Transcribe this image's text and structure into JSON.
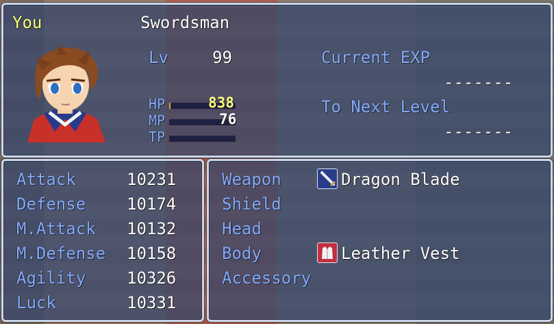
{
  "actor": {
    "name": "You",
    "class": "Swordsman",
    "level_label": "Lv",
    "level": "99",
    "hp_label": "HP",
    "hp": "838",
    "hp_fill_fraction": 0.02,
    "mp_label": "MP",
    "mp": "76",
    "mp_fill_fraction": 0,
    "tp_label": "TP",
    "tp_fill_fraction": 0
  },
  "exp": {
    "current_label": "Current EXP",
    "current_value": "-------",
    "next_label": "To Next Level",
    "next_value": "-------"
  },
  "params": [
    {
      "label": "Attack",
      "value": "10231"
    },
    {
      "label": "Defense",
      "value": "10174"
    },
    {
      "label": "M.Attack",
      "value": "10132"
    },
    {
      "label": "M.Defense",
      "value": "10158"
    },
    {
      "label": "Agility",
      "value": "10326"
    },
    {
      "label": "Luck",
      "value": "10331"
    }
  ],
  "equipment": [
    {
      "slot": "Weapon",
      "item": "Dragon Blade",
      "icon": "sword-icon"
    },
    {
      "slot": "Shield",
      "item": "",
      "icon": ""
    },
    {
      "slot": "Head",
      "item": "",
      "icon": ""
    },
    {
      "slot": "Body",
      "item": "Leather Vest",
      "icon": "vest-icon"
    },
    {
      "slot": "Accessory",
      "item": "",
      "icon": ""
    }
  ],
  "colors": {
    "system_text": "#84aaff",
    "name_text": "#ffff80",
    "window_border": "#c9d6e8"
  }
}
